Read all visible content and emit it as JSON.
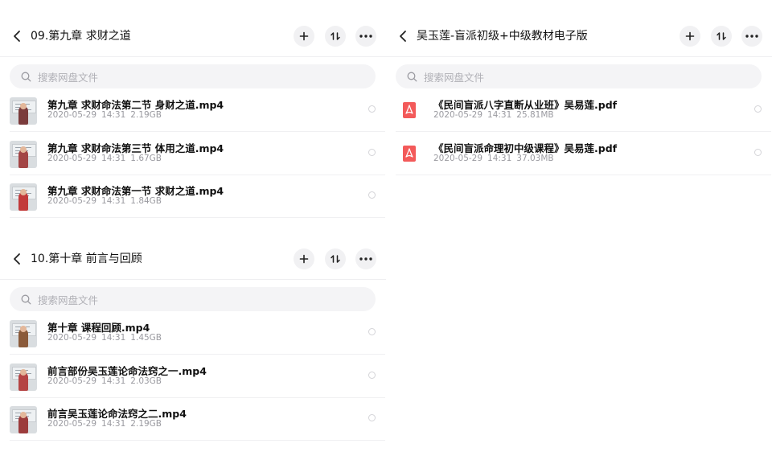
{
  "left_top": {
    "title": "09.第九章 求财之道",
    "search_placeholder": "搜索网盘文件",
    "files": [
      {
        "name": "第九章 求财命法第二节 身财之道.mp4",
        "date": "2020-05-29",
        "time": "14:31",
        "size": "2.19GB"
      },
      {
        "name": "第九章 求财命法第三节 体用之道.mp4",
        "date": "2020-05-29",
        "time": "14:31",
        "size": "1.67GB"
      },
      {
        "name": "第九章 求财命法第一节 求财之道.mp4",
        "date": "2020-05-29",
        "time": "14:31",
        "size": "1.84GB"
      }
    ]
  },
  "left_bottom": {
    "title": "10.第十章 前言与回顾",
    "search_placeholder": "搜索网盘文件",
    "files": [
      {
        "name": "第十章  课程回顾.mp4",
        "date": "2020-05-29",
        "time": "14:31",
        "size": "1.45GB"
      },
      {
        "name": "前言部份吴玉莲论命法窍之一.mp4",
        "date": "2020-05-29",
        "time": "14:31",
        "size": "2.03GB"
      },
      {
        "name": "前言吴玉莲论命法窍之二.mp4",
        "date": "2020-05-29",
        "time": "14:31",
        "size": "2.19GB"
      }
    ]
  },
  "right": {
    "title": "吴玉莲-盲派初级+中级教材电子版",
    "search_placeholder": "搜索网盘文件",
    "files": [
      {
        "name": "《民间盲派八字直断从业班》吴易莲.pdf",
        "date": "2020-05-29",
        "time": "14:31",
        "size": "25.81MB"
      },
      {
        "name": "《民间盲派命理初中级课程》吴易莲.pdf",
        "date": "2020-05-29",
        "time": "14:31",
        "size": "37.03MB"
      }
    ]
  },
  "icons": {
    "back": "chevron-left-icon",
    "add": "plus-icon",
    "sort": "sort-icon",
    "more": "more-dots-icon",
    "search": "search-icon",
    "video": "video-thumbnail",
    "pdf": "pdf-icon"
  },
  "colors": {
    "pdf": "#f35a5a",
    "button_bg": "#f1f1f3",
    "search_bg": "#f4f4f6",
    "meta_text": "#9a9aa0"
  }
}
